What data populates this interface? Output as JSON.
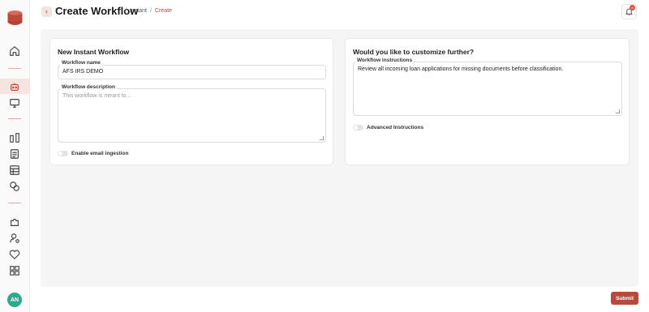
{
  "header": {
    "title": "Create Workflow",
    "breadcrumb": [
      "Instant",
      "Create"
    ],
    "notification_count": "0"
  },
  "sidebar": {
    "icons": [
      "home-icon",
      "bot-icon",
      "monitor-icon",
      "columns-icon",
      "document-icon",
      "table-icon",
      "chat-icon",
      "puzzle-icon",
      "user-settings-icon",
      "heart-icon",
      "apps-icon"
    ],
    "avatar_initials": "AN"
  },
  "left_card": {
    "title": "New Instant Workflow",
    "name_label": "Workflow name",
    "name_value": "AFS IRS DEMO",
    "desc_label": "Workflow description",
    "desc_placeholder": "This workflow is meant to...",
    "toggle_label": "Enable email ingestion"
  },
  "right_card": {
    "title": "Would you like to customize further?",
    "instructions_label": "Workflow instructions",
    "instructions_value": "Review all incoming loan applications for missing documents before classification.",
    "toggle_label": "Advanced Instructions"
  },
  "actions": {
    "submit_label": "Submit"
  },
  "colors": {
    "accent": "#b84a3c",
    "avatar": "#2fa98e"
  }
}
